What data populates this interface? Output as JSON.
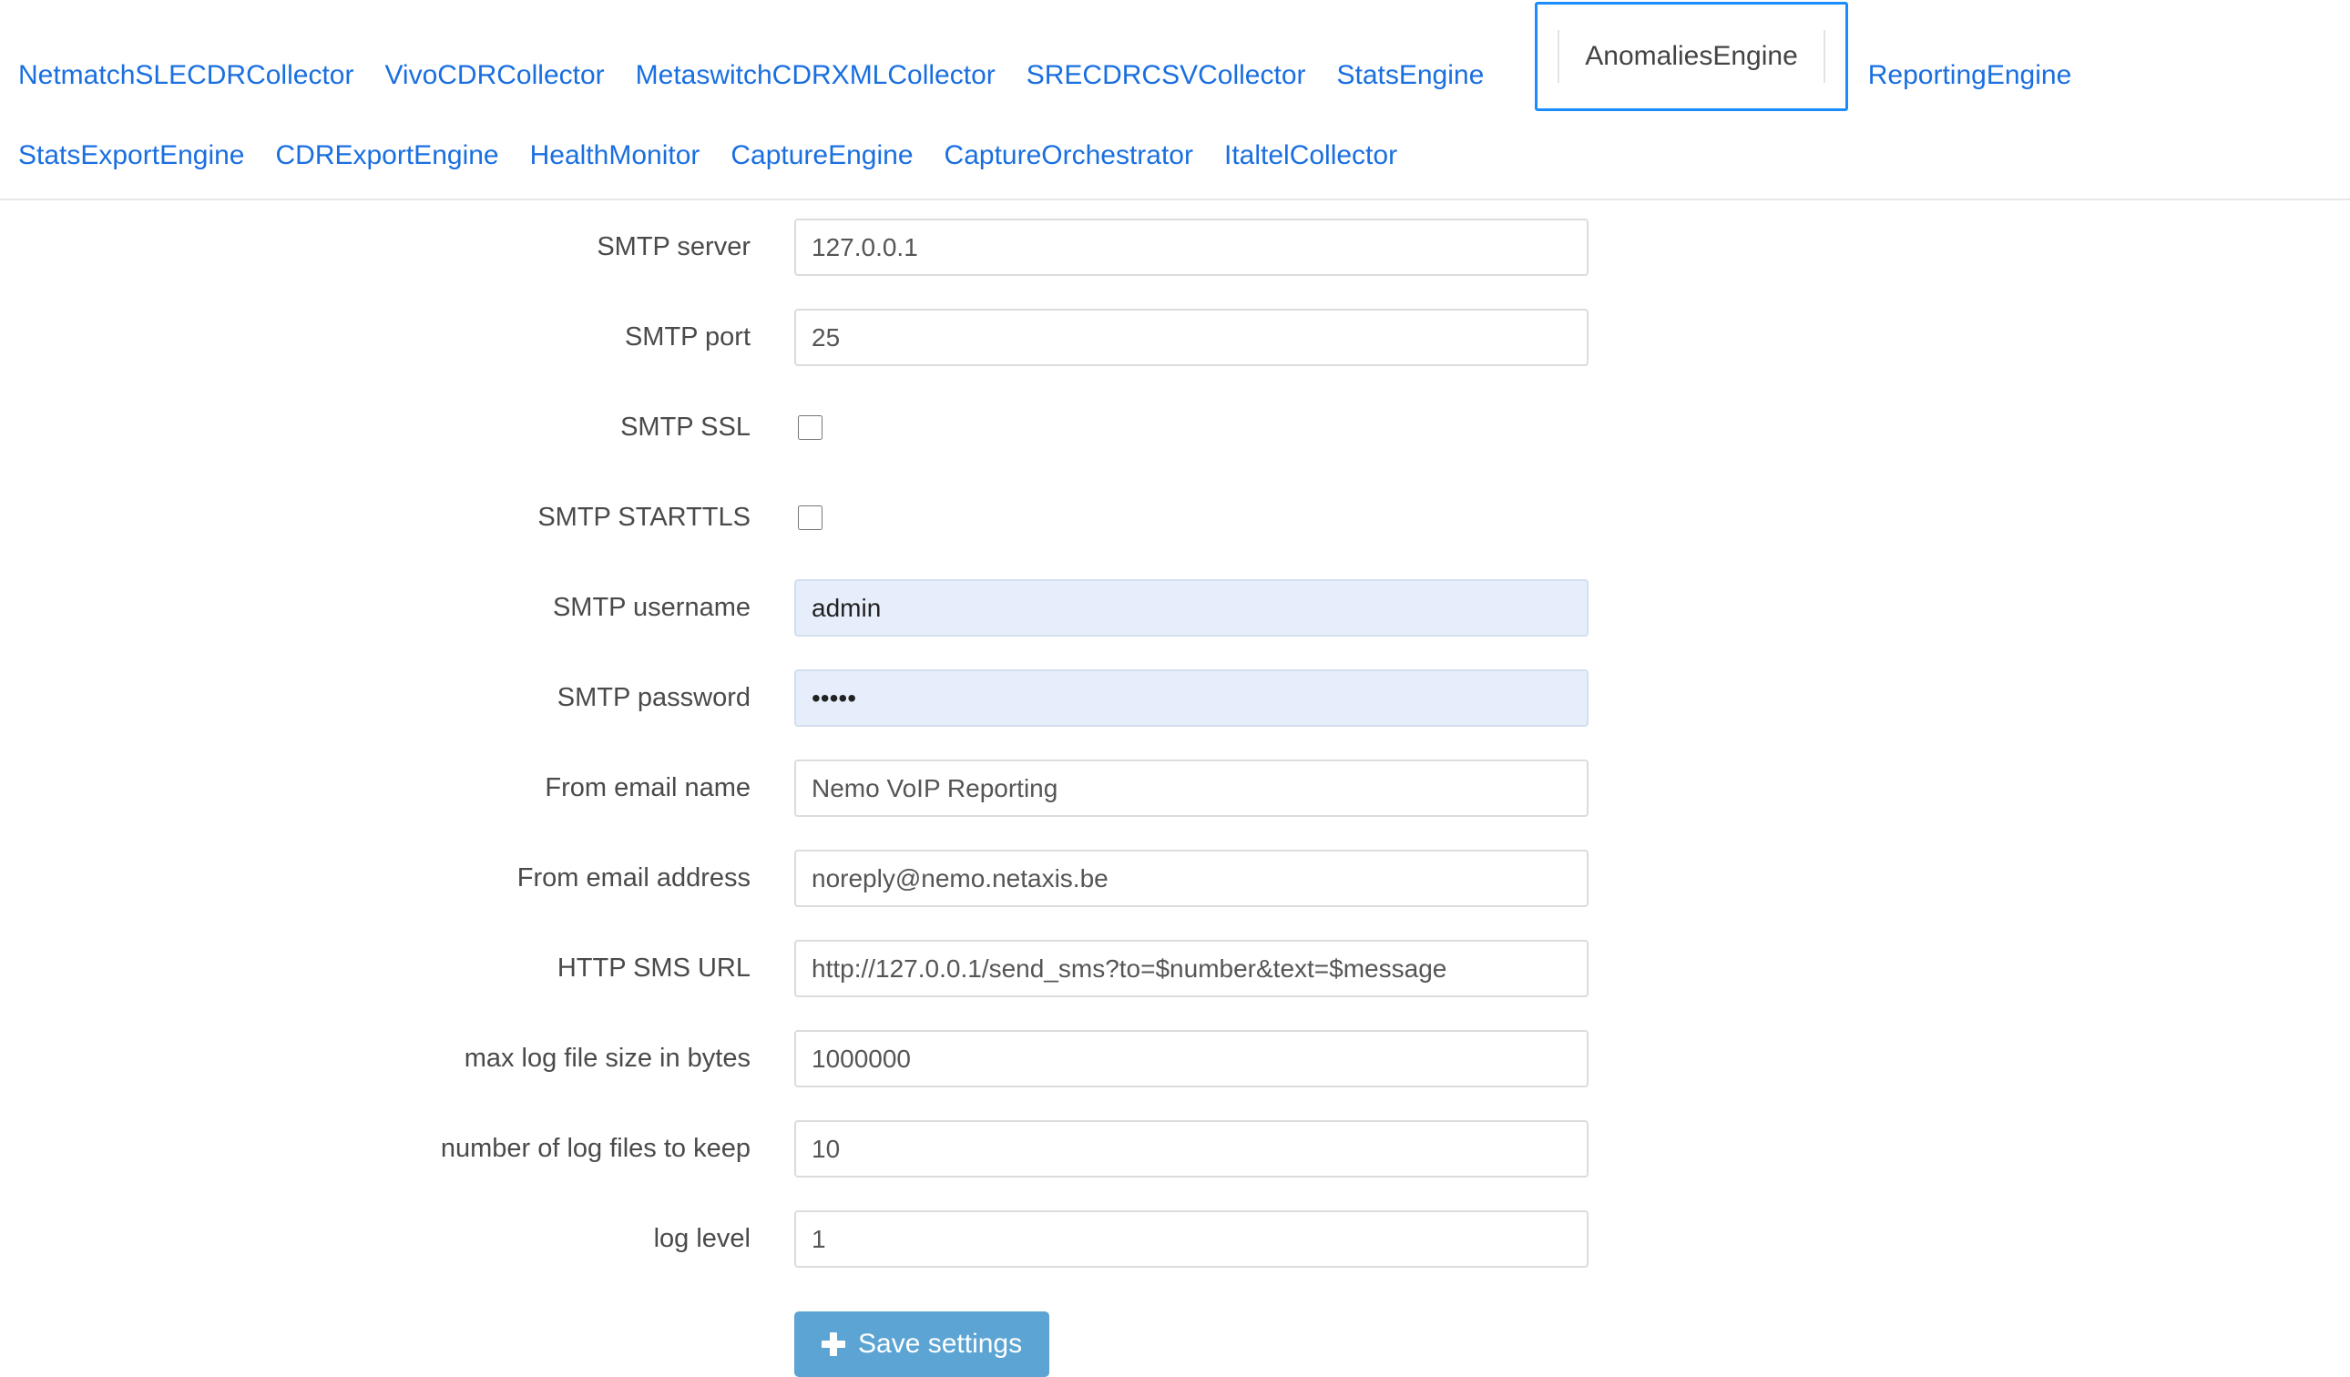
{
  "tabs": [
    {
      "label": "NetmatchSLECDRCollector",
      "active": false
    },
    {
      "label": "VivoCDRCollector",
      "active": false
    },
    {
      "label": "MetaswitchCDRXMLCollector",
      "active": false
    },
    {
      "label": "SRECDRCSVCollector",
      "active": false
    },
    {
      "label": "StatsEngine",
      "active": false
    },
    {
      "label": "AnomaliesEngine",
      "active": true
    },
    {
      "label": "ReportingEngine",
      "active": false
    },
    {
      "label": "StatsExportEngine",
      "active": false
    },
    {
      "label": "CDRExportEngine",
      "active": false
    },
    {
      "label": "HealthMonitor",
      "active": false
    },
    {
      "label": "CaptureEngine",
      "active": false
    },
    {
      "label": "CaptureOrchestrator",
      "active": false
    },
    {
      "label": "ItaltelCollector",
      "active": false
    }
  ],
  "form": {
    "fields": [
      {
        "label": "SMTP server",
        "type": "text",
        "value": "127.0.0.1",
        "autofilled": false
      },
      {
        "label": "SMTP port",
        "type": "text",
        "value": "25",
        "autofilled": false
      },
      {
        "label": "SMTP SSL",
        "type": "checkbox",
        "checked": false
      },
      {
        "label": "SMTP STARTTLS",
        "type": "checkbox",
        "checked": false
      },
      {
        "label": "SMTP username",
        "type": "text",
        "value": "admin",
        "autofilled": true
      },
      {
        "label": "SMTP password",
        "type": "password",
        "value": "•••••",
        "autofilled": true
      },
      {
        "label": "From email name",
        "type": "text",
        "value": "Nemo VoIP Reporting",
        "autofilled": false
      },
      {
        "label": "From email address",
        "type": "text",
        "value": "noreply@nemo.netaxis.be",
        "autofilled": false
      },
      {
        "label": "HTTP SMS URL",
        "type": "text",
        "value": "http://127.0.0.1/send_sms?to=$number&text=$message",
        "autofilled": false
      },
      {
        "label": "max log file size in bytes",
        "type": "text",
        "value": "1000000",
        "autofilled": false
      },
      {
        "label": "number of log files to keep",
        "type": "text",
        "value": "10",
        "autofilled": false
      },
      {
        "label": "log level",
        "type": "text",
        "value": "1",
        "autofilled": false
      }
    ],
    "save_label": "Save settings",
    "save_icon": "plus-icon"
  },
  "colors": {
    "link": "#1a6fe0",
    "focus_ring": "#1a8cff",
    "save_button": "#5ba4d4",
    "autofill_bg": "#e6eefb",
    "input_border": "#dcdcdc"
  }
}
